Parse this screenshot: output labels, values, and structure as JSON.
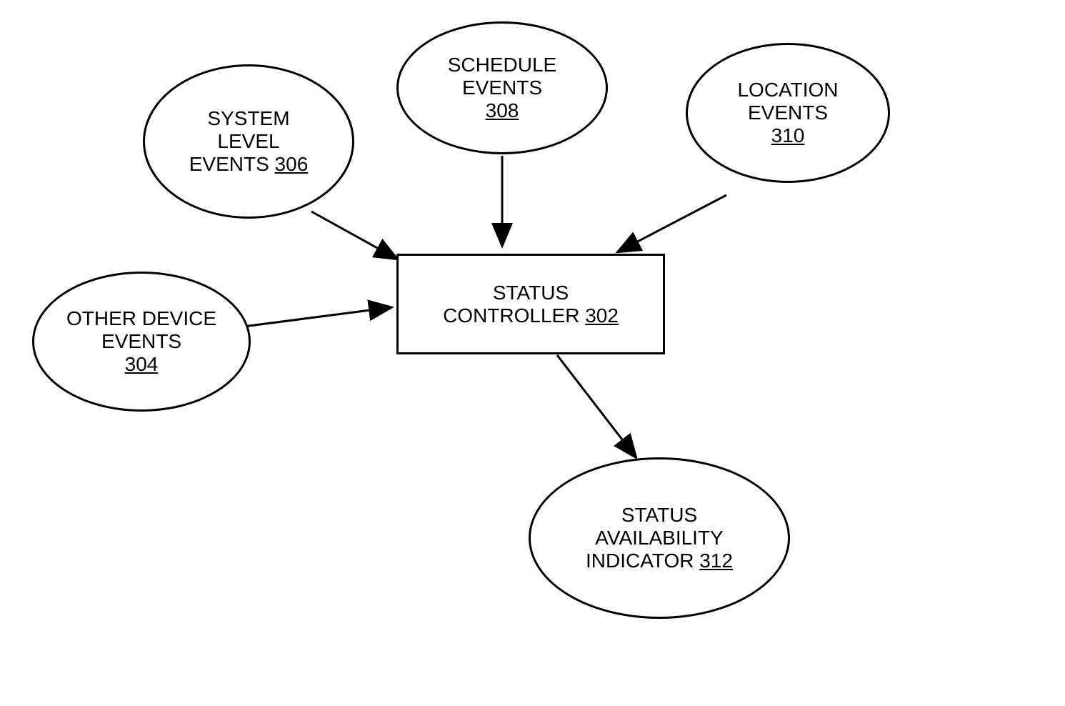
{
  "nodes": {
    "systemLevel": {
      "line1": "SYSTEM",
      "line2": "LEVEL",
      "line3": "EVENTS",
      "ref": "306"
    },
    "schedule": {
      "line1": "SCHEDULE",
      "line2": "EVENTS",
      "ref": "308"
    },
    "location": {
      "line1": "LOCATION",
      "line2": "EVENTS",
      "ref": "310"
    },
    "otherDevice": {
      "line1": "OTHER DEVICE",
      "line2": "EVENTS",
      "ref": "304"
    },
    "statusController": {
      "line1": "STATUS",
      "line2": "CONTROLLER",
      "ref": "302"
    },
    "statusAvailability": {
      "line1": "STATUS",
      "line2": "AVAILABILITY",
      "line3": "INDICATOR",
      "ref": "312"
    }
  }
}
